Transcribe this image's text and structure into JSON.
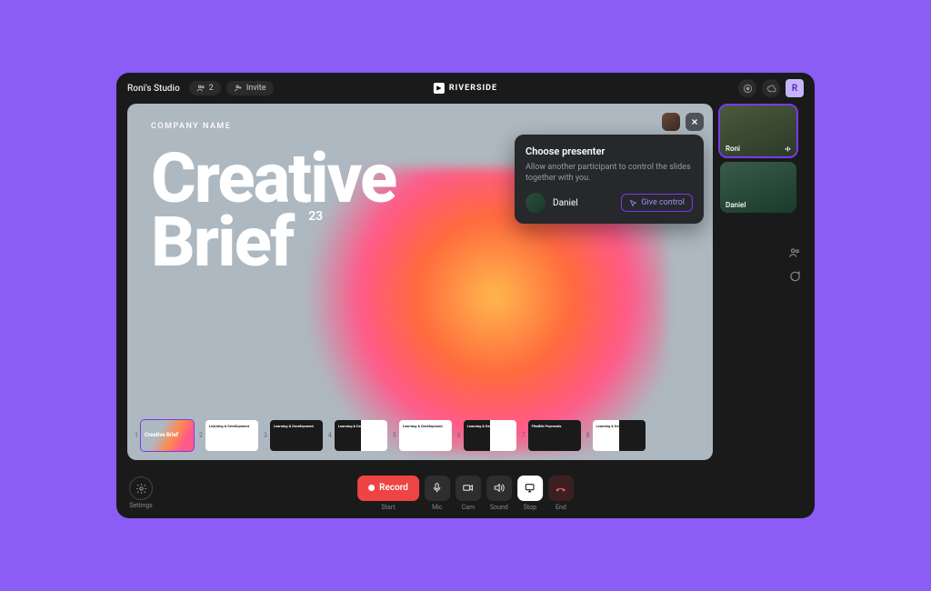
{
  "header": {
    "studio_name": "Roni's Studio",
    "participant_count": "2",
    "invite_label": "Invite",
    "brand": "RIVERSIDE",
    "avatar_initial": "R"
  },
  "slide": {
    "company_label": "COMPANY NAME",
    "title_line1": "Creative",
    "title_line2": "Brief",
    "title_badge": "23"
  },
  "popover": {
    "title": "Choose presenter",
    "subtitle": "Allow another participant to control the slides together with you.",
    "presenter_name": "Daniel",
    "give_label": "Give control"
  },
  "thumbnails": [
    {
      "n": "1",
      "label": "Creative Brief",
      "variant": "cb"
    },
    {
      "n": "2",
      "label": "Learning & Development",
      "variant": "white"
    },
    {
      "n": "3",
      "label": "Learning & Development",
      "variant": "dark"
    },
    {
      "n": "4",
      "label": "Learning & Development",
      "variant": "split"
    },
    {
      "n": "5",
      "label": "Learning & Development",
      "variant": "white"
    },
    {
      "n": "6",
      "label": "Learning & Development",
      "variant": "split"
    },
    {
      "n": "7",
      "label": "Flexible Payments",
      "variant": "dark"
    },
    {
      "n": "8",
      "label": "Learning & Development",
      "variant": "split2"
    }
  ],
  "participants": [
    {
      "name": "Roni"
    },
    {
      "name": "Daniel"
    }
  ],
  "controls": {
    "settings": "Settings",
    "record": "Record",
    "start": "Start",
    "mic": "Mic",
    "cam": "Cam",
    "sound": "Sound",
    "stop": "Stop",
    "end": "End"
  }
}
